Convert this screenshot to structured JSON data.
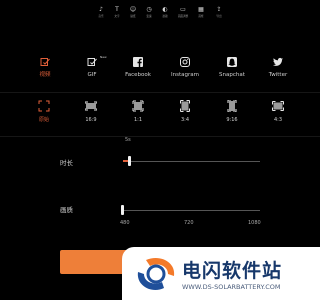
{
  "toolbar": [
    {
      "icon": "music-icon",
      "glyph": "♪",
      "label": "音乐"
    },
    {
      "icon": "text-icon",
      "glyph": "T",
      "label": "文字"
    },
    {
      "icon": "sticker-icon",
      "glyph": "☺",
      "label": "贴纸"
    },
    {
      "icon": "speed-icon",
      "glyph": "◷",
      "label": "变速"
    },
    {
      "icon": "filter-icon",
      "glyph": "◐",
      "label": "滤镜"
    },
    {
      "icon": "screen-icon",
      "glyph": "▭",
      "label": "画面调整"
    },
    {
      "icon": "frame-icon",
      "glyph": "▦",
      "label": "画框"
    },
    {
      "icon": "export-icon",
      "glyph": "⇪",
      "label": "导出"
    }
  ],
  "output_formats": [
    {
      "label": "视频",
      "icon": "video-icon",
      "active": true
    },
    {
      "label": "GIF",
      "icon": "gif-icon",
      "badge": "New",
      "active": false
    },
    {
      "label": "Facebook",
      "icon": "facebook-icon",
      "active": false
    },
    {
      "label": "Instagram",
      "icon": "instagram-icon",
      "active": false
    },
    {
      "label": "Snapchat",
      "icon": "snapchat-icon",
      "active": false
    },
    {
      "label": "Twitter",
      "icon": "twitter-icon",
      "active": false
    }
  ],
  "aspect_ratios": [
    {
      "label": "原始",
      "icon": "original-ratio-icon",
      "active": true
    },
    {
      "label": "16:9",
      "icon": "ratio-16-9-icon",
      "active": false
    },
    {
      "label": "1:1",
      "icon": "ratio-1-1-icon",
      "active": false
    },
    {
      "label": "3:4",
      "icon": "ratio-3-4-icon",
      "active": false
    },
    {
      "label": "9:16",
      "icon": "ratio-9-16-icon",
      "active": false
    },
    {
      "label": "4:3",
      "icon": "ratio-4-3-icon",
      "active": false
    }
  ],
  "duration": {
    "label": "时长",
    "value": "5s",
    "position": 0.05
  },
  "quality": {
    "label": "画质",
    "options": [
      "480",
      "720",
      "1080"
    ],
    "position": 0.0
  },
  "watermark": {
    "name": "电闪软件站",
    "url": "WWW.DS-SOLARBATTERY.COM"
  },
  "colors": {
    "accent": "#e2603a",
    "button": "#ee7f39",
    "background": "#000000"
  }
}
